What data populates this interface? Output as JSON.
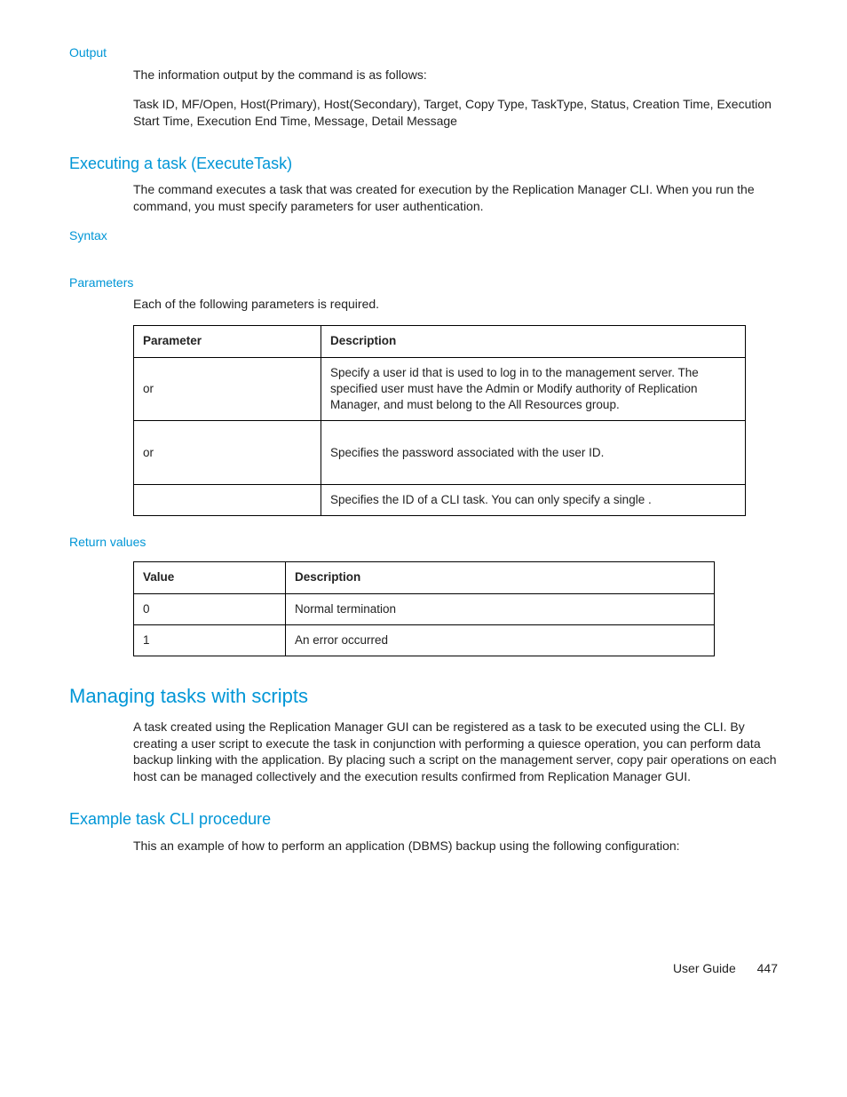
{
  "output": {
    "label": "Output",
    "line1_a": "The information output by the ",
    "line1_b": " command is as follows:",
    "line2": "Task ID, MF/Open, Host(Primary), Host(Secondary), Target, Copy Type, TaskType, Status, Creation Time, Execution Start Time, Execution End Time, Message, Detail Message"
  },
  "exec": {
    "heading": "Executing a task (ExecuteTask)",
    "p_a": "The ",
    "p_b": " command executes a task that was created for execution by the Replication Manager CLI. When you run the ",
    "p_c": " command, you must specify parameters for user authentication."
  },
  "syntax": {
    "label": "Syntax"
  },
  "params": {
    "label": "Parameters",
    "intro": "Each of the following parameters is required.",
    "head_param": "Parameter",
    "head_desc": "Description",
    "rows": [
      {
        "param": "or",
        "desc": "Specify a user id that is used to log in to the management server. The specified user must have the Admin or Modify authority of Replication Manager, and must belong to the All Resources group."
      },
      {
        "param": "or",
        "desc": "Specifies the password associated with the user ID."
      },
      {
        "param": "",
        "desc": "Specifies the ID of a CLI task. You can only specify a single                    ."
      }
    ]
  },
  "returns": {
    "label": "Return values",
    "head_val": "Value",
    "head_desc": "Description",
    "rows": [
      {
        "val": "0",
        "desc": "Normal termination"
      },
      {
        "val": "1",
        "desc": "An error occurred"
      }
    ]
  },
  "scripts": {
    "heading": "Managing tasks with scripts",
    "p": "A task created using the Replication Manager GUI can be registered as a task to be executed using the CLI. By creating a user script to execute the task in conjunction with performing a quiesce operation, you can perform data backup linking with the application. By placing such a script on the management server, copy pair operations on each host can be managed collectively and the execution results confirmed from Replication Manager GUI."
  },
  "example": {
    "heading": "Example task CLI procedure",
    "p": "This an example of how to perform an application (DBMS) backup using the following configuration:"
  },
  "footer": {
    "doc": "User Guide",
    "page": "447"
  }
}
